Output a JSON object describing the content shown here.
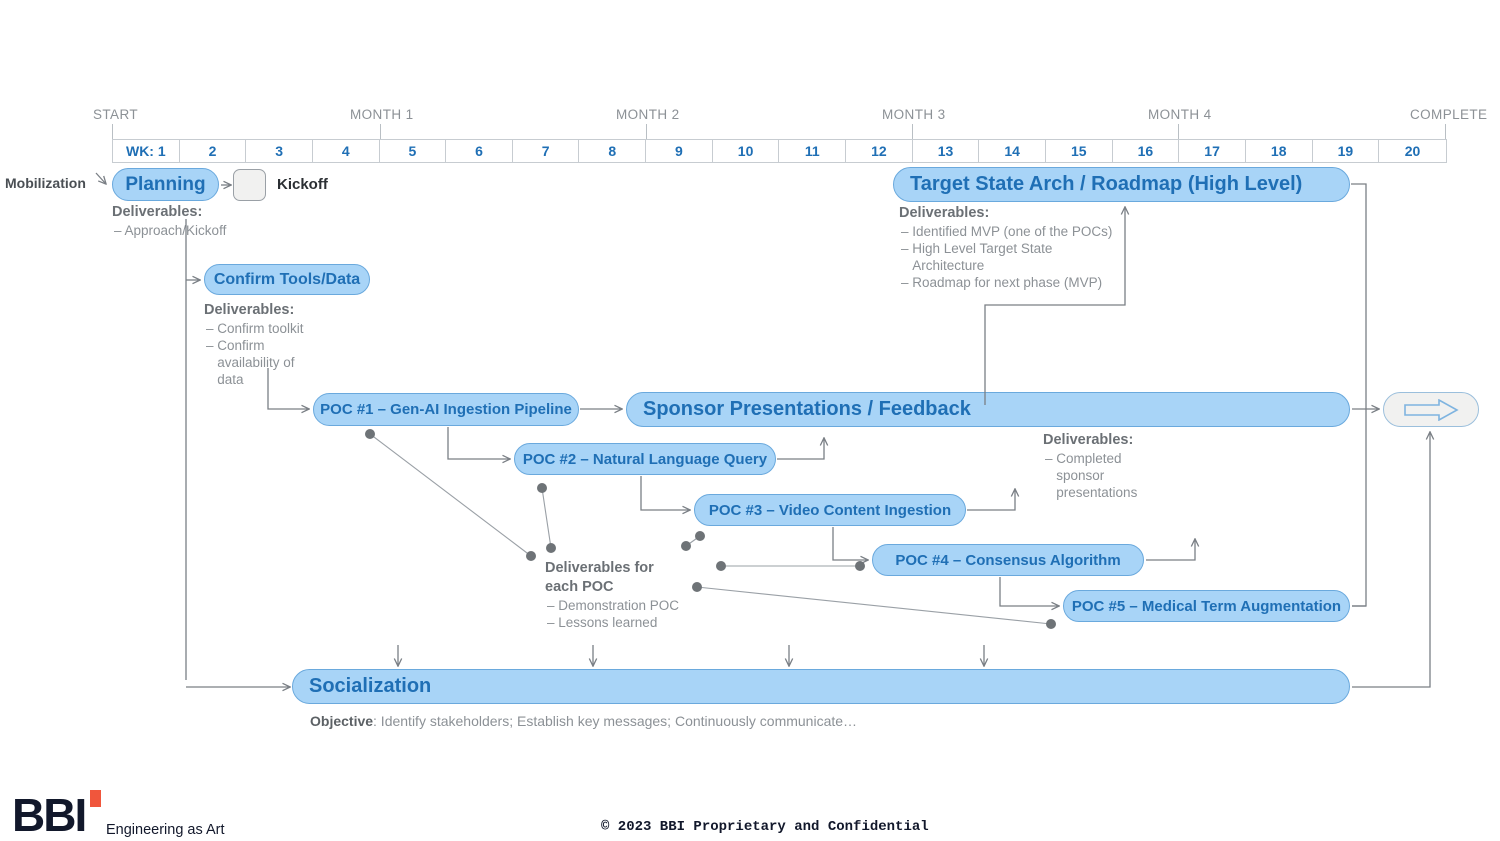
{
  "timeline": {
    "start_label": "START",
    "complete_label": "COMPLETE",
    "month_labels": [
      "MONTH 1",
      "MONTH 2",
      "MONTH 3",
      "MONTH 4"
    ],
    "week_prefix": "WK:",
    "weeks": [
      "1",
      "2",
      "3",
      "4",
      "5",
      "6",
      "7",
      "8",
      "9",
      "10",
      "11",
      "12",
      "13",
      "14",
      "15",
      "16",
      "17",
      "18",
      "19",
      "20"
    ]
  },
  "swimlane": {
    "mobilization_label": "Mobilization"
  },
  "tasks": {
    "planning": "Planning",
    "kickoff": "Kickoff",
    "confirm_tools": "Confirm  Tools/Data",
    "poc1": "POC #1 – Gen-AI Ingestion Pipeline",
    "poc2": "POC #2 – Natural Language Query",
    "poc3": "POC #3 – Video Content Ingestion",
    "poc4": "POC #4 – Consensus Algorithm",
    "poc5": "POC #5 – Medical Term Augmentation",
    "sponsor": "Sponsor Presentations / Feedback",
    "target_state": "Target State Arch / Roadmap (High Level)",
    "socialization": "Socialization"
  },
  "deliverables": {
    "heading": "Deliverables:",
    "planning": [
      "– Approach/Kickoff"
    ],
    "confirm_tools": [
      "– Confirm toolkit",
      "– Confirm\n   availability of\n   data"
    ],
    "target_state": [
      "– Identified MVP (one of the POCs)",
      "– High Level Target State\n   Architecture",
      "– Roadmap for next phase (MVP)"
    ],
    "sponsor": [
      "– Completed\n   sponsor\n   presentations"
    ],
    "poc_heading": "Deliverables for\neach POC",
    "poc_items": [
      "– Demonstration POC",
      "– Lessons learned"
    ]
  },
  "socialization": {
    "objective_label": "Objective",
    "objective_text": ": Identify stakeholders; Establish key messages; Continuously communicate…"
  },
  "footer": {
    "logo": "BBI",
    "tagline": "Engineering as Art",
    "copyright": "© 2023 BBI Proprietary and Confidential"
  },
  "colors": {
    "pill_fill": "#a8d4f7",
    "pill_border": "#6aa9dd",
    "pill_text": "#1f6fb5",
    "connector": "#7a7f85",
    "grid_line": "#c7ccd1",
    "muted_text": "#8c9196",
    "accent_red": "#f0563c"
  }
}
